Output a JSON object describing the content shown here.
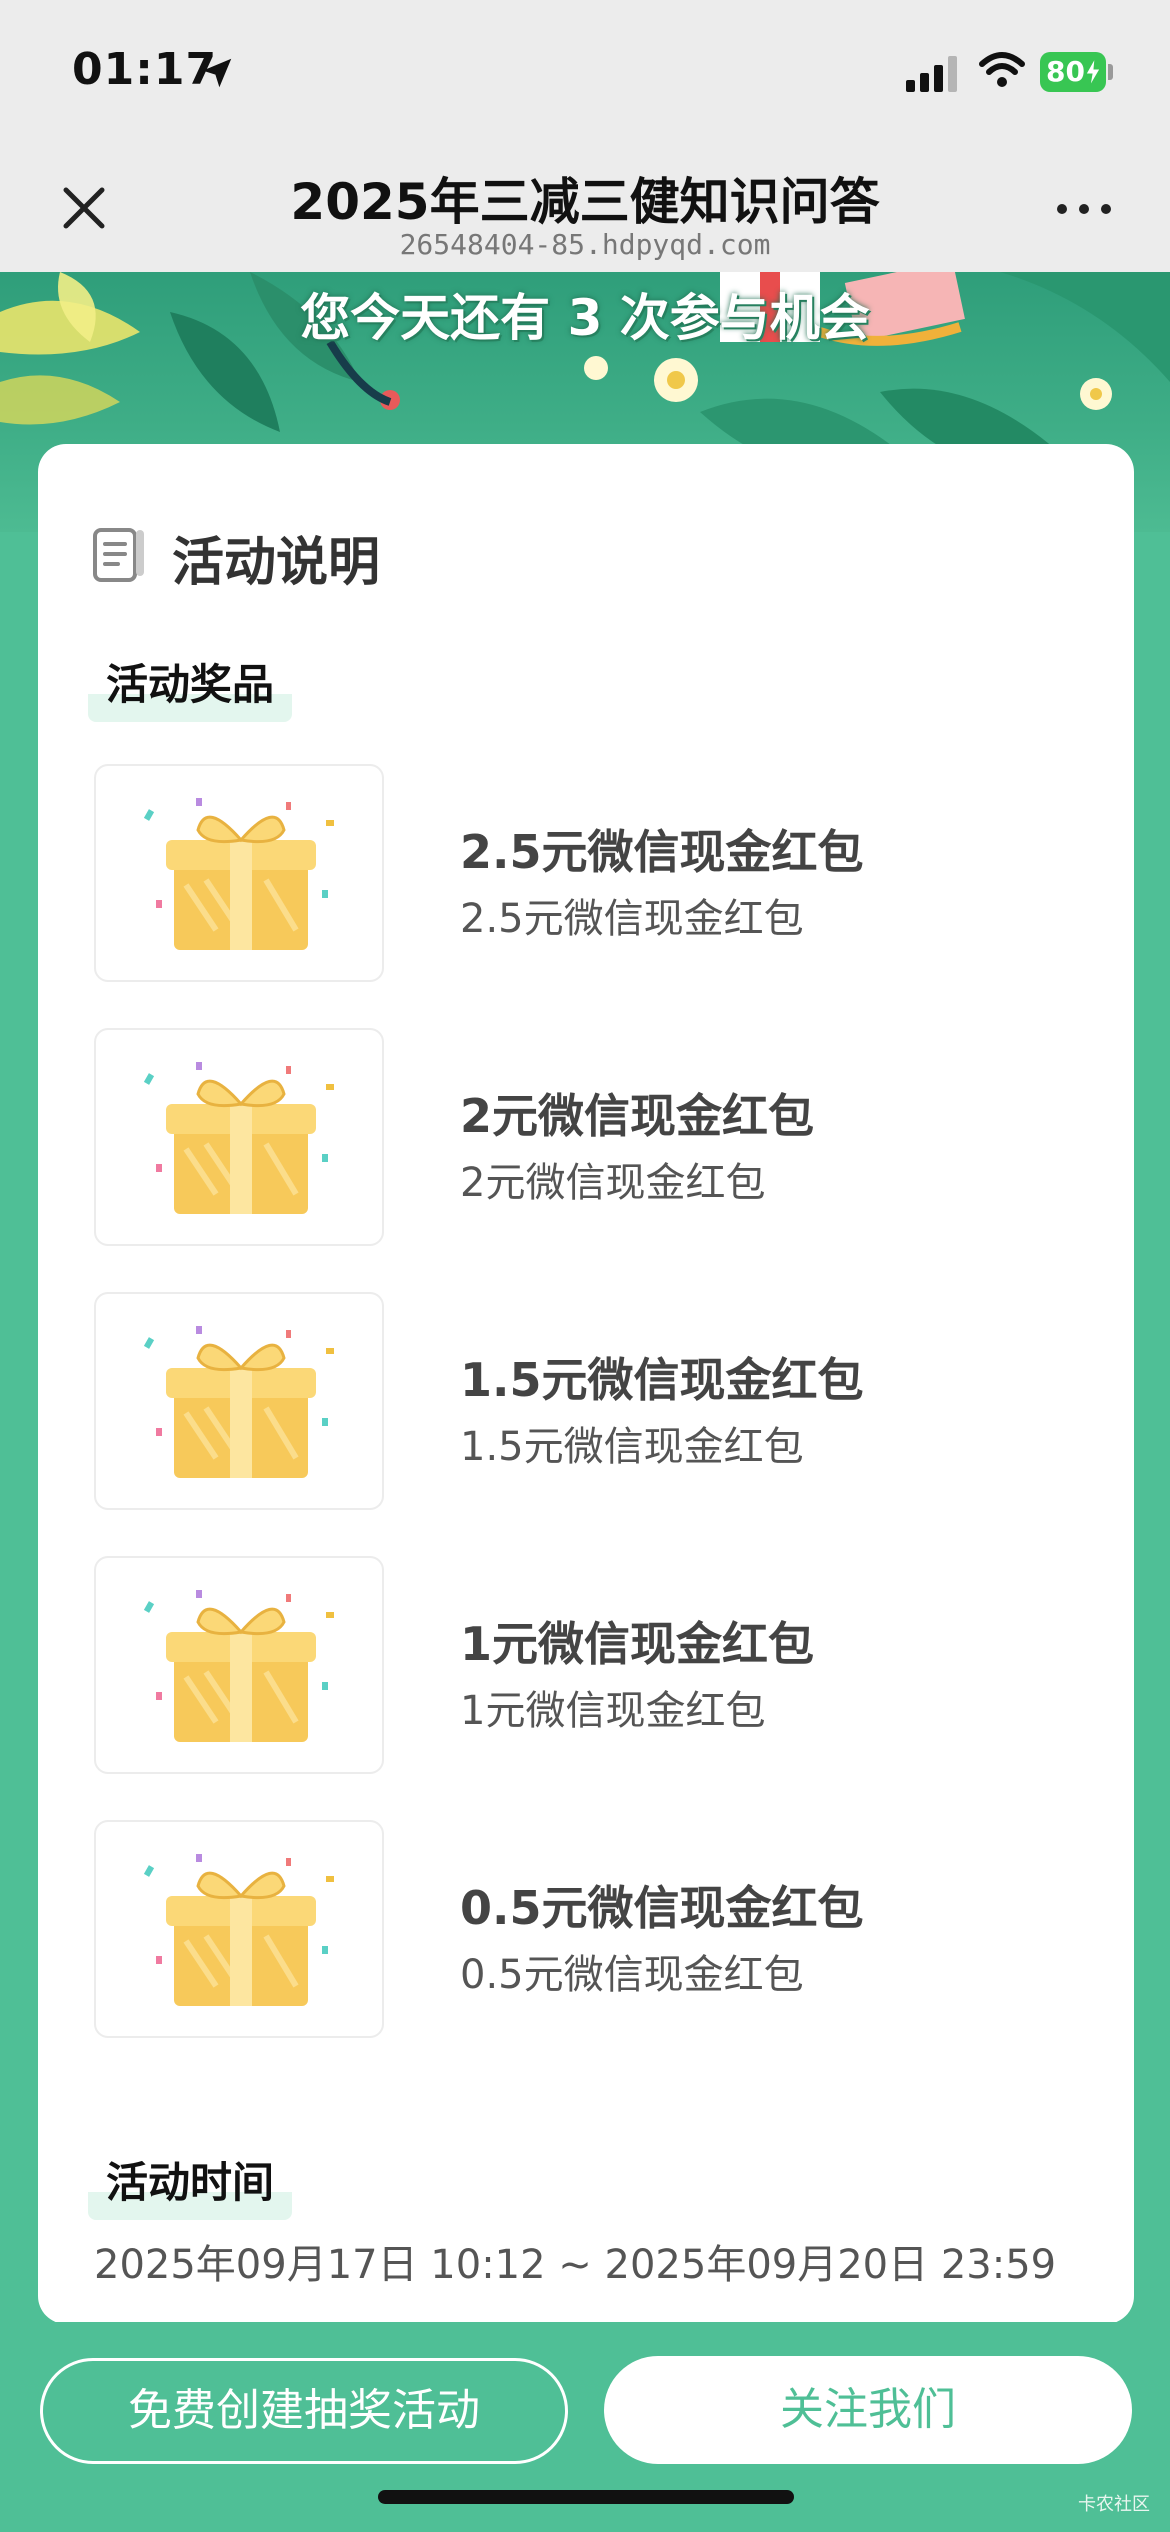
{
  "status": {
    "time": "01:17",
    "battery": "80"
  },
  "header": {
    "title": "2025年三减三健知识问答",
    "url": "26548404-85.hdpyqd.com"
  },
  "banner": {
    "chances_text": "您今天还有 3 次参与机会"
  },
  "section": {
    "title": "活动说明",
    "prizes_tag": "活动奖品",
    "time_tag": "活动时间",
    "time_range": "2025年09月17日 10:12 ~ 2025年09月20日 23:59"
  },
  "prizes": [
    {
      "name": "2.5元微信现金红包",
      "desc": "2.5元微信现金红包"
    },
    {
      "name": "2元微信现金红包",
      "desc": "2元微信现金红包"
    },
    {
      "name": "1.5元微信现金红包",
      "desc": "1.5元微信现金红包"
    },
    {
      "name": "1元微信现金红包",
      "desc": "1元微信现金红包"
    },
    {
      "name": "0.5元微信现金红包",
      "desc": "0.5元微信现金红包"
    }
  ],
  "buttons": {
    "create": "免费创建抽奖活动",
    "follow": "关注我们"
  },
  "watermark": "卡农社区",
  "colors": {
    "accent": "#4fbf96",
    "banner": "#2f9e7a",
    "gift": "#f7c95a"
  }
}
